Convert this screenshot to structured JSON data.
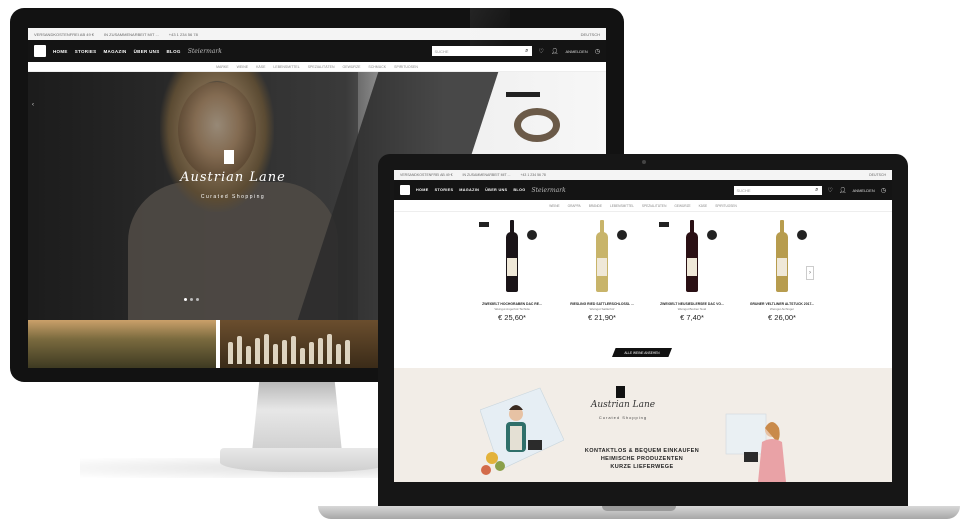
{
  "site": {
    "topbar": {
      "shipping_note": "VERSANDKOSTENFREI AB 49 €",
      "delivery_note": "IN ZUSAMMENARBEIT MIT ...",
      "phone": "+43 1 234 56 78",
      "language": "DEUTSCH"
    },
    "nav": {
      "home": "HOME",
      "stories": "STORIES",
      "magazin": "MAGAZIN",
      "ueber_uns": "ÜBER UNS",
      "blog": "BLOG",
      "script_brand": "Steiermark",
      "search_placeholder": "SUCHE",
      "account": "ANMELDEN"
    },
    "categories_imac": [
      "MARKE",
      "WEINE",
      "KÄSE",
      "LEBENSMITTEL",
      "SPEZIALITÄTEN",
      "GEWÜRZE",
      "SCHMUCK",
      "SPIRITUOSEN"
    ],
    "categories_mbp": [
      "WEINE",
      "GRAPPA",
      "BRÄNDE",
      "LEBENSMITTEL",
      "SPEZIALITÄTEN",
      "GEWÜRZE",
      "KÄSE",
      "SPIRITUOSEN"
    ]
  },
  "hero": {
    "brand_script": "Austrian Lane",
    "brand_sub": "Curated Shopping"
  },
  "products": [
    {
      "name": "ZWEIGELT HOCHGRABEN DAC RE...",
      "producer": "Weingut Angerhof-Tschida",
      "price": "€ 25,60*",
      "bottle": "#1a1418",
      "has_badge": true
    },
    {
      "name": "RIESLING RIED SATTLERSCHLÖSSL ...",
      "producer": "Weingut Sattlerhof",
      "price": "€ 21,90*",
      "bottle": "#c8b46a",
      "has_badge": false
    },
    {
      "name": "ZWEIGELT NEUSIEDLERSEE DAC VO...",
      "producer": "Weingut Bodner Noél",
      "price": "€ 7,40*",
      "bottle": "#2a1014",
      "has_badge": true
    },
    {
      "name": "GRÜNER VELTLINER ALTSTÜCK 2017...",
      "producer": "Weingut Aichinger",
      "price": "€ 26,00*",
      "bottle": "#b79c4e",
      "has_badge": false
    }
  ],
  "all_button": "ALLE WEINE ANSEHEN",
  "banner": {
    "script": "Austrian Lane",
    "sub": "Curated Shopping",
    "line1": "KONTAKTLOS & BEQUEM EINKAUFEN",
    "line2": "HEIMISCHE PRODUZENTEN",
    "line3": "KURZE LIEFERWEGE"
  }
}
